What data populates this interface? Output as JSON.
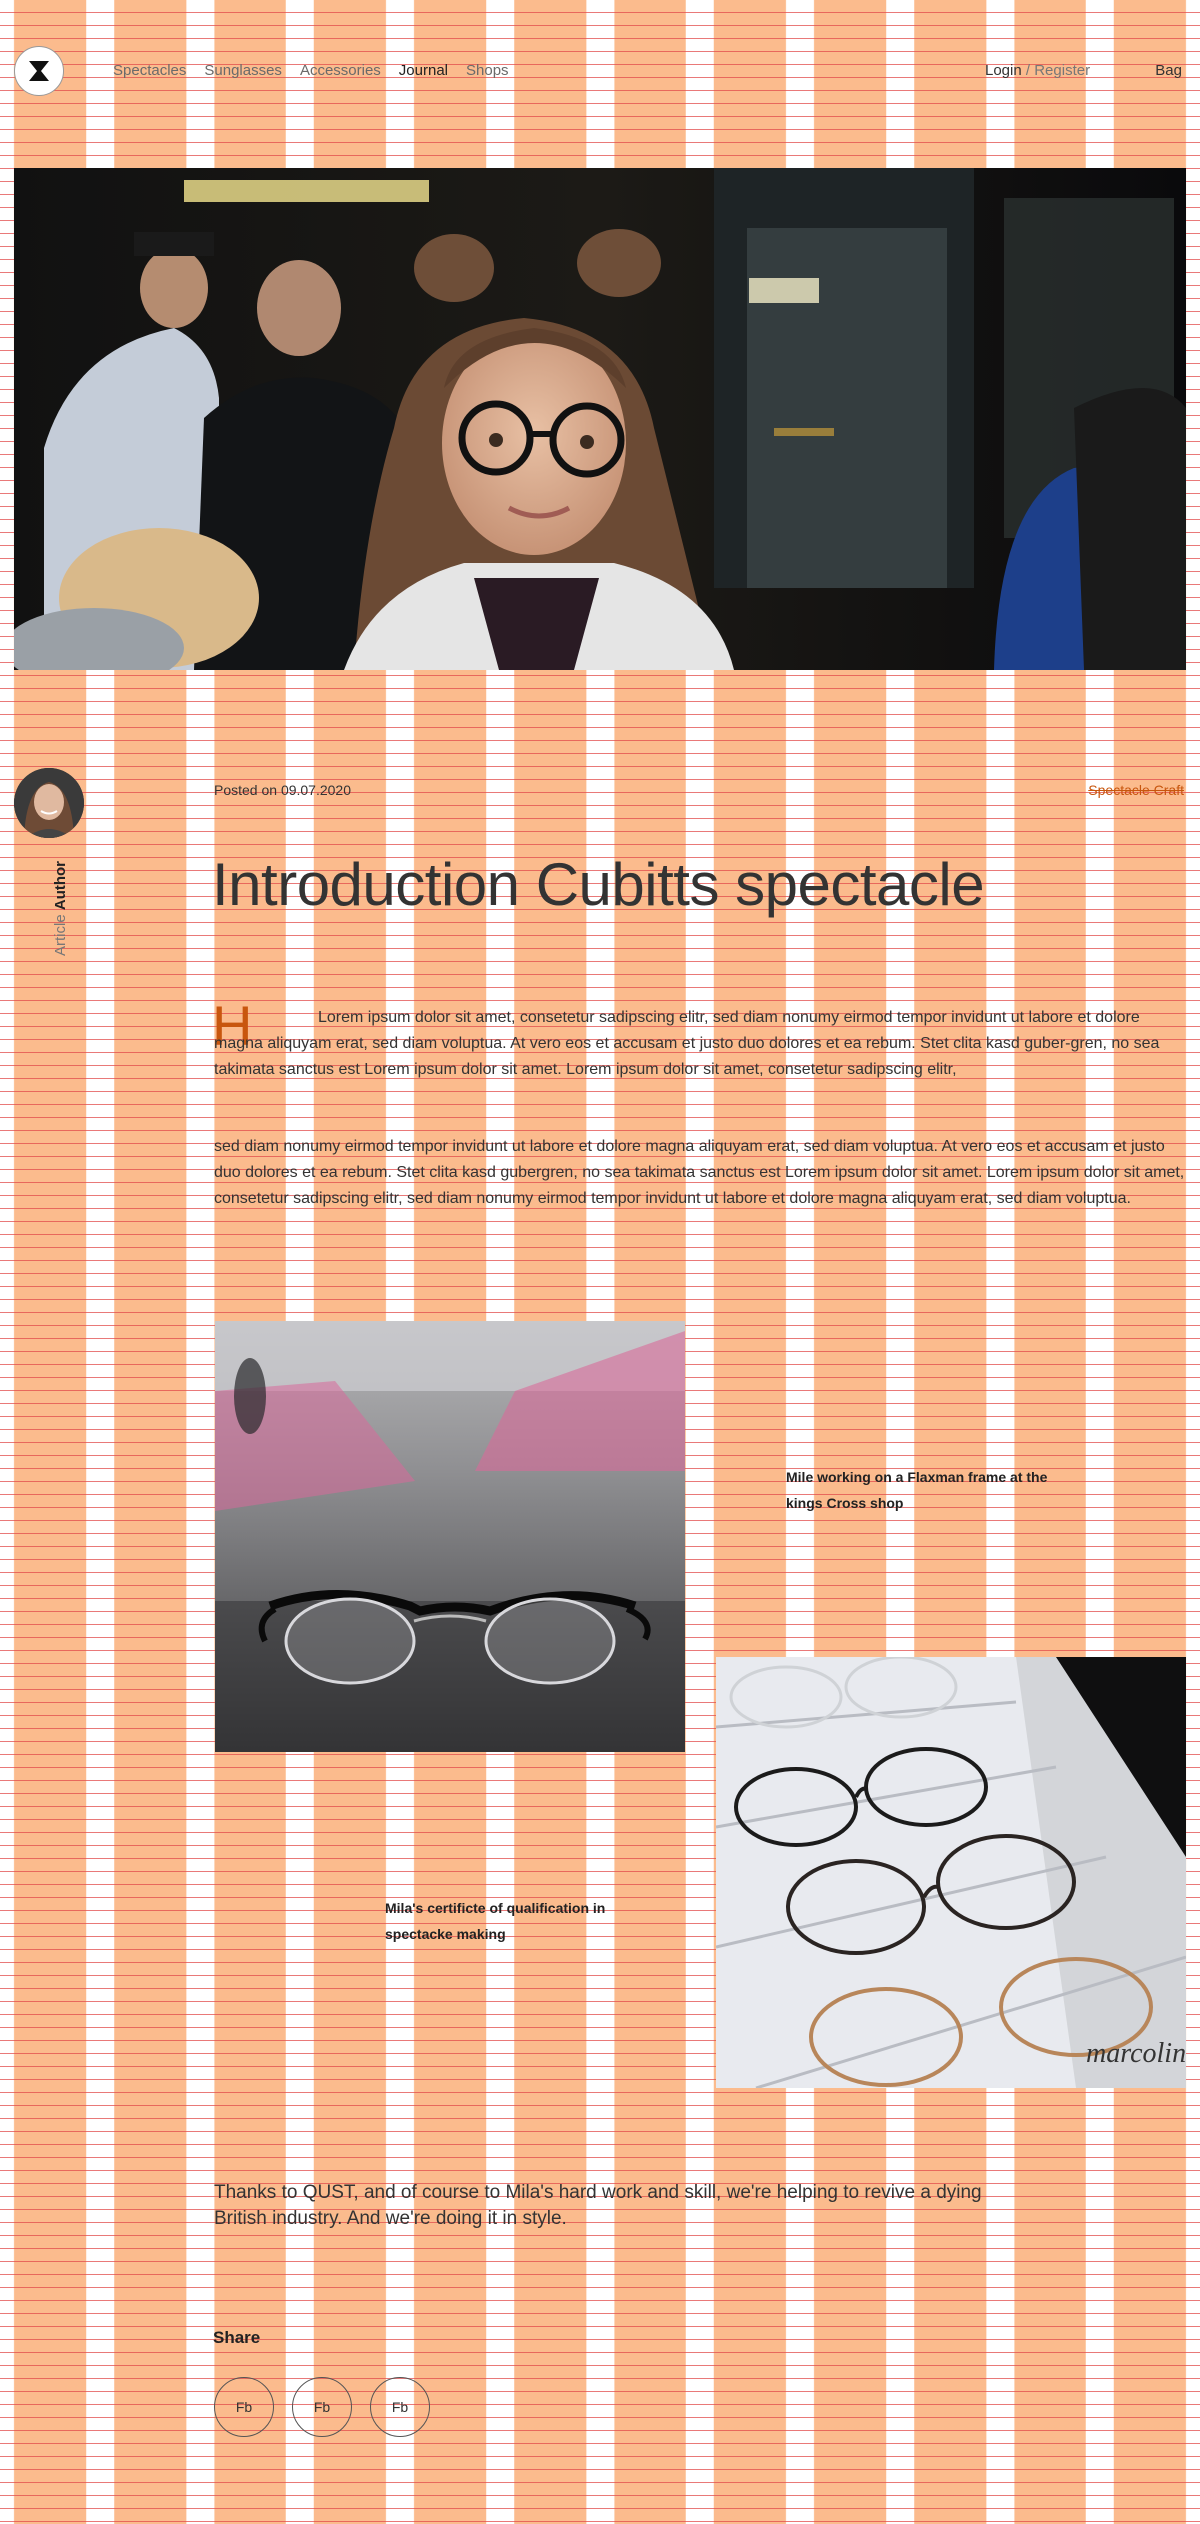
{
  "header": {
    "nav": [
      "Spectacles",
      "Sunglasses",
      "Accessories",
      "Journal",
      "Shops"
    ],
    "active_nav": "Journal",
    "login": "Login",
    "separator": "/",
    "register": "Register",
    "bag": "Bag"
  },
  "article": {
    "author_key": "Article",
    "author_value": "Author",
    "posted": "Posted on 09.07.2020",
    "category": "Spectacle Craft",
    "title": "Introduction Cubitts spectacle",
    "dropcap": "H",
    "paragraph1": "Lorem ipsum dolor sit amet, consetetur sadipscing elitr, sed diam nonumy eirmod tempor invidunt ut labore et dolore magna aliquyam erat, sed diam voluptua. At vero eos et accusam et justo duo dolores et ea rebum. Stet clita kasd guber-gren, no sea takimata sanctus est Lorem ipsum dolor sit amet. Lorem ipsum dolor sit amet, consetetur sadipscing elitr,",
    "paragraph2": "sed diam nonumy eirmod tempor invidunt ut labore et dolore magna aliquyam erat, sed diam voluptua. At vero eos et accusam et justo duo dolores et ea rebum. Stet clita kasd gubergren, no sea takimata sanctus est Lorem ipsum dolor sit amet. Lorem ipsum dolor sit amet, consetetur sadipscing elitr, sed diam nonumy eirmod tempor invidunt ut labore et dolore magna aliquyam erat, sed diam voluptua.",
    "caption1": "Mile working on a Flaxman frame at the kings Cross shop",
    "caption2": "Mila's certificte of qualification in spectacke making",
    "closing": "Thanks to QUST, and of course to Mila's hard work and skill, we're helping to revive a dying British industry. And we're doing it in style."
  },
  "share": {
    "label": "Share",
    "buttons": [
      "Fb",
      "Fb",
      "Fb"
    ]
  },
  "colors": {
    "grid_column": "#fbbb8d",
    "grid_row_line": "#e24c4c",
    "accent": "#c8560e",
    "text": "#222222"
  },
  "icons": [
    "brand-logo-icon"
  ]
}
